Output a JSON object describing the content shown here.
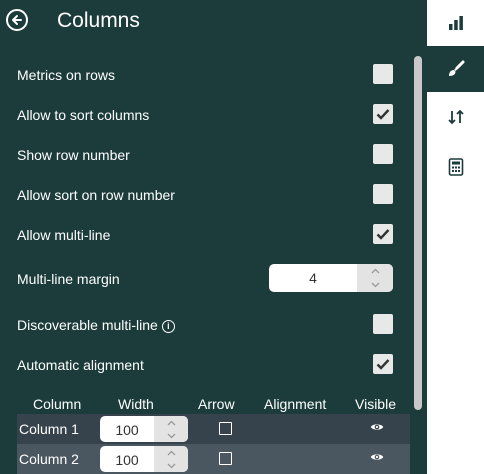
{
  "header": {
    "title": "Columns"
  },
  "options": [
    {
      "label": "Metrics on rows",
      "checked": false
    },
    {
      "label": "Allow to sort columns",
      "checked": true
    },
    {
      "label": "Show row number",
      "checked": false
    },
    {
      "label": "Allow sort on row number",
      "checked": false
    },
    {
      "label": "Allow multi-line",
      "checked": true
    }
  ],
  "multiline_margin": {
    "label": "Multi-line margin",
    "value": "4"
  },
  "discoverable": {
    "label": "Discoverable multi-line",
    "checked": false
  },
  "auto_align": {
    "label": "Automatic alignment",
    "checked": true
  },
  "table": {
    "headers": [
      "Column",
      "Width",
      "Arrow",
      "Alignment",
      "Visible"
    ],
    "rows": [
      {
        "name": "Column 1",
        "width": "100"
      },
      {
        "name": "Column 2",
        "width": "100"
      }
    ]
  },
  "sidebar": {
    "tabs": [
      "bar-chart-icon",
      "brush-icon",
      "sort-arrows-icon",
      "calculator-icon"
    ],
    "active": "brush-icon"
  },
  "colors": {
    "panel": "#1c3c3c",
    "checkbox": "#e8e8e8",
    "row1": "#36434d",
    "row2": "#4a5760"
  }
}
